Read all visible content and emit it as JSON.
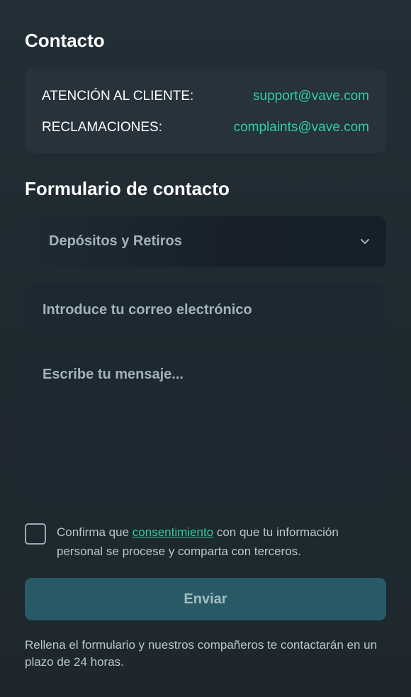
{
  "contact": {
    "title": "Contacto",
    "rows": [
      {
        "label": "ATENCIÓN AL CLIENTE:",
        "value": "support@vave.com"
      },
      {
        "label": "RECLAMACIONES:",
        "value": "complaints@vave.com"
      }
    ]
  },
  "form": {
    "title": "Formulario de contacto",
    "topic": {
      "selected": "Depósitos y Retiros",
      "icon": "chevron-down-icon"
    },
    "email": {
      "placeholder": "Introduce tu correo electrónico",
      "value": ""
    },
    "message": {
      "placeholder": "Escribe tu mensaje...",
      "value": ""
    },
    "consent": {
      "checked": false,
      "prefix": "Confirma que ",
      "link": "consentimiento",
      "suffix": " con que tu información personal se procese y comparta con terceros."
    },
    "submit_label": "Enviar",
    "note": "Rellena el formulario y nuestros compañeros te contactarán en un plazo de 24 horas."
  },
  "colors": {
    "accent": "#2ecf9f",
    "button": "#285a66",
    "background": "#1f2930"
  }
}
